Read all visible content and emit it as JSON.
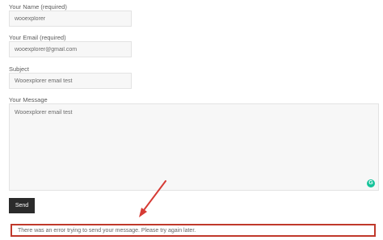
{
  "form": {
    "name_label": "Your Name (required)",
    "name_value": "wooexplorer",
    "email_label": "Your Email (required)",
    "email_value": "wooexplorer@gmail.com",
    "subject_label": "Subject",
    "subject_value": "Wooexplorer email test",
    "message_label": "Your Message",
    "message_value": "Wooexplorer email test",
    "grammarly_glyph": "G",
    "send_label": "Send"
  },
  "error": {
    "message": "There was an error trying to send your message. Please try again later."
  },
  "colors": {
    "error_border": "#c0392b",
    "arrow": "#d63b35",
    "button_bg": "#2b2b2b",
    "grammarly": "#15c39a"
  },
  "icons": {
    "grammarly": "grammarly-icon",
    "annotation_arrow": "arrow-icon"
  }
}
